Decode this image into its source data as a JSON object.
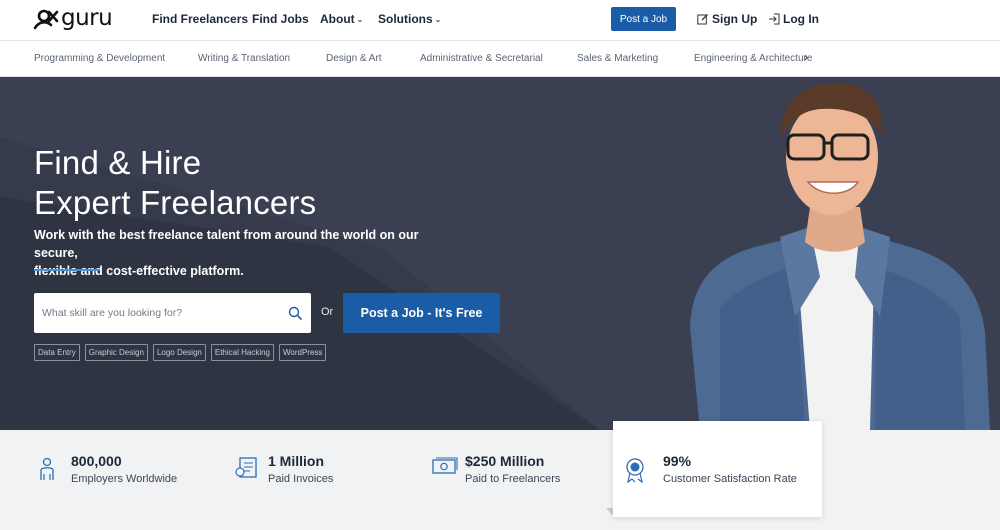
{
  "brand": {
    "name": "guru"
  },
  "nav": {
    "links": [
      {
        "label": "Find Freelancers"
      },
      {
        "label": "Find Jobs"
      },
      {
        "label": "About"
      },
      {
        "label": "Solutions"
      }
    ],
    "post_job": "Post a Job",
    "sign_up": "Sign Up",
    "log_in": "Log In"
  },
  "categories": [
    "Programming & Development",
    "Writing & Translation",
    "Design & Art",
    "Administrative & Secretarial",
    "Sales & Marketing",
    "Engineering & Architecture"
  ],
  "hero": {
    "title_line1": "Find & Hire",
    "title_line2": "Expert Freelancers",
    "subtitle_line1": "Work with the best freelance talent from around the world on our secure,",
    "subtitle_line2": "flexible and cost-effective platform.",
    "search_placeholder": "What skill are you looking for?",
    "or": "Or",
    "cta": "Post a Job - It's Free",
    "tags": [
      "Data Entry",
      "Graphic Design",
      "Logo Design",
      "Ethical Hacking",
      "WordPress"
    ]
  },
  "stats": [
    {
      "value": "800,000",
      "label": "Employers Worldwide",
      "icon": "person-icon"
    },
    {
      "value": "1 Million",
      "label": "Paid Invoices",
      "icon": "invoice-icon"
    },
    {
      "value": "$250 Million",
      "label": "Paid to Freelancers",
      "icon": "money-icon"
    },
    {
      "value": "99%",
      "label": "Customer Satisfaction Rate",
      "icon": "award-icon"
    }
  ],
  "colors": {
    "accent": "#1a5da6",
    "hero_bg": "#363b4c",
    "stats_bg": "#f1f2f4"
  }
}
